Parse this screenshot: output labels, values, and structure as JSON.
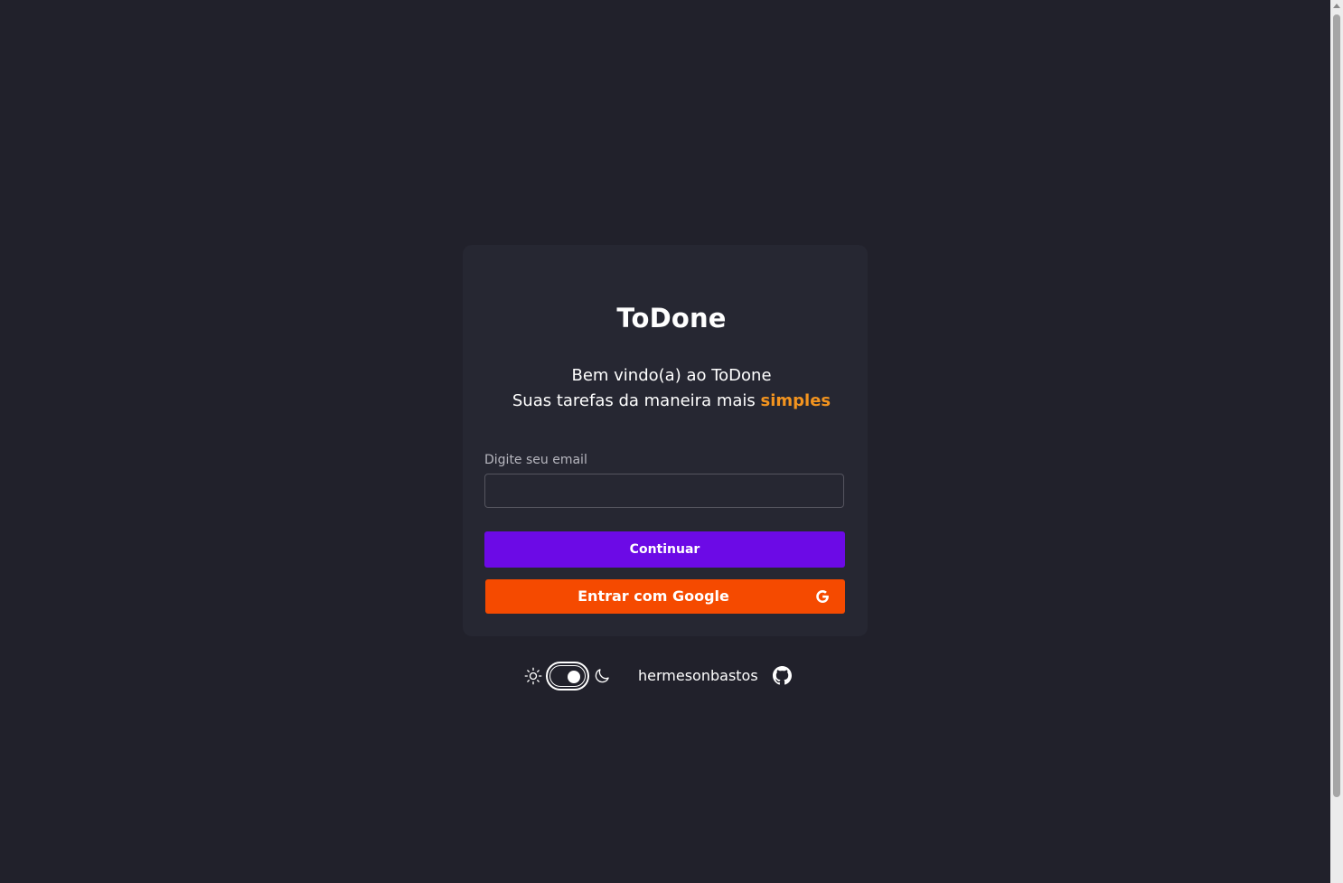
{
  "app": {
    "title": "ToDone"
  },
  "welcome": {
    "line1": "Bem vindo(a) ao ToDone",
    "line2_prefix": "Suas tarefas da maneira mais ",
    "line2_accent": "simples"
  },
  "form": {
    "email_label": "Digite seu email",
    "email_value": "",
    "email_placeholder": "",
    "continue_label": "Continuar",
    "google_label": "Entrar com Google"
  },
  "footer": {
    "theme": "dark",
    "author": "hermesonbastos"
  },
  "icons": {
    "google": "google-g-icon",
    "sun": "sun-icon",
    "moon": "moon-icon",
    "github": "github-icon"
  },
  "colors": {
    "background": "#21212b",
    "card": "#262732",
    "accent_text": "#f3941f",
    "primary_button": "#6c0ae6",
    "google_button": "#f54a00"
  }
}
